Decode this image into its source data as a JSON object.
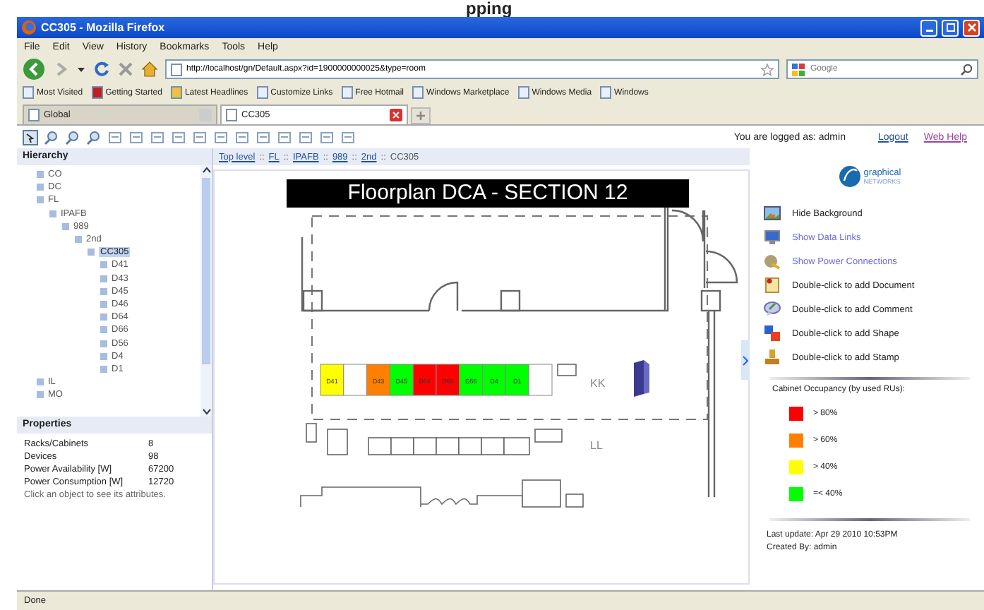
{
  "slide_title_fragment": "pping",
  "window": {
    "title": "CC305 - Mozilla Firefox"
  },
  "menu": [
    "File",
    "Edit",
    "View",
    "History",
    "Bookmarks",
    "Tools",
    "Help"
  ],
  "address_bar": {
    "value": "http://localhost/gn/Default.aspx?id=1900000000025&type=room"
  },
  "search": {
    "placeholder": "Google"
  },
  "bookmarks": [
    "Most Visited",
    "Getting Started",
    "Latest Headlines",
    "Customize Links",
    "Free Hotmail",
    "Windows Marketplace",
    "Windows Media",
    "Windows"
  ],
  "tabs": [
    {
      "label": "Global",
      "selected": false
    },
    {
      "label": "CC305",
      "selected": true
    }
  ],
  "app": {
    "user_text": "You are logged as: admin",
    "links": [
      "Logout",
      "Web Help"
    ],
    "hierarchy": {
      "title": "Hierarchy",
      "tree": [
        {
          "label": "CO",
          "selected": false
        },
        {
          "label": "DC",
          "selected": false
        },
        {
          "label": "FL",
          "selected": false,
          "children": [
            {
              "label": "IPAFB",
              "selected": false,
              "children": [
                {
                  "label": "989",
                  "selected": false,
                  "children": [
                    {
                      "label": "2nd",
                      "selected": false,
                      "children": [
                        {
                          "label": "CC305",
                          "selected": true,
                          "children": [
                            {
                              "label": "D41",
                              "selected": false
                            },
                            {
                              "label": "D43",
                              "selected": false
                            },
                            {
                              "label": "D45",
                              "selected": false
                            },
                            {
                              "label": "D46",
                              "selected": false
                            },
                            {
                              "label": "D64",
                              "selected": false
                            },
                            {
                              "label": "D66",
                              "selected": false
                            },
                            {
                              "label": "D56",
                              "selected": false
                            },
                            {
                              "label": "D4",
                              "selected": false
                            },
                            {
                              "label": "D1",
                              "selected": false
                            }
                          ]
                        }
                      ]
                    }
                  ]
                }
              ]
            }
          ]
        },
        {
          "label": "IL",
          "selected": false
        },
        {
          "label": "MO",
          "selected": false
        }
      ]
    },
    "breadcrumb": {
      "separator": "::",
      "links": [
        "Top level",
        "FL",
        "IPAFB",
        "989",
        "2nd"
      ],
      "current": "CC305"
    },
    "properties": {
      "title": "Properties",
      "rows": [
        {
          "label": "Racks/Cabinets",
          "value": "8"
        },
        {
          "label": "Devices",
          "value": "98"
        },
        {
          "label": "Power Availability [W]",
          "value": "67200"
        },
        {
          "label": "Power Consumption [W]",
          "value": "12720"
        }
      ],
      "note": "Click an object to see its attributes."
    },
    "floorplan": {
      "title": "Floorplan DCA - SECTION 12",
      "cabinets": [
        {
          "label": "D41",
          "color": "#ffff00"
        },
        {
          "color": "#ffffff"
        },
        {
          "label": "D43",
          "color": "#ff8000"
        },
        {
          "label": "D45",
          "color": "#00ff00"
        },
        {
          "label": "D64",
          "color": "#ff0000"
        },
        {
          "label": "D66",
          "color": "#ff0000"
        },
        {
          "label": "D56",
          "color": "#00ff00"
        },
        {
          "label": "D4",
          "color": "#00ff00"
        },
        {
          "label": "D1",
          "color": "#00ff00"
        },
        {
          "color": "#ffffff"
        }
      ],
      "zones": [
        "KK",
        "LL"
      ]
    },
    "side_panel": {
      "logo_top": "graphical",
      "logo_bottom": "NETWORKS",
      "actions": [
        {
          "label": "Hide Background",
          "kind": "action"
        },
        {
          "label": "Show Data Links",
          "kind": "link"
        },
        {
          "label": "Show Power Connections",
          "kind": "link"
        },
        {
          "label": "Double-click to add Document",
          "kind": "action"
        },
        {
          "label": "Double-click to add Comment",
          "kind": "action"
        },
        {
          "label": "Double-click to add Shape",
          "kind": "action"
        },
        {
          "label": "Double-click to add Stamp",
          "kind": "action"
        }
      ],
      "legend": {
        "title": "Cabinet Occupancy (by used RUs):",
        "items": [
          {
            "label": "> 80%",
            "color": "#ff0000"
          },
          {
            "label": "> 60%",
            "color": "#ff8000"
          },
          {
            "label": "> 40%",
            "color": "#ffff00"
          },
          {
            "label": "=< 40%",
            "color": "#00ff00"
          }
        ]
      },
      "last_update": "Last update: Apr 29 2010 10:53PM",
      "created_by": "Created By: admin"
    }
  },
  "status_bar": "Done"
}
